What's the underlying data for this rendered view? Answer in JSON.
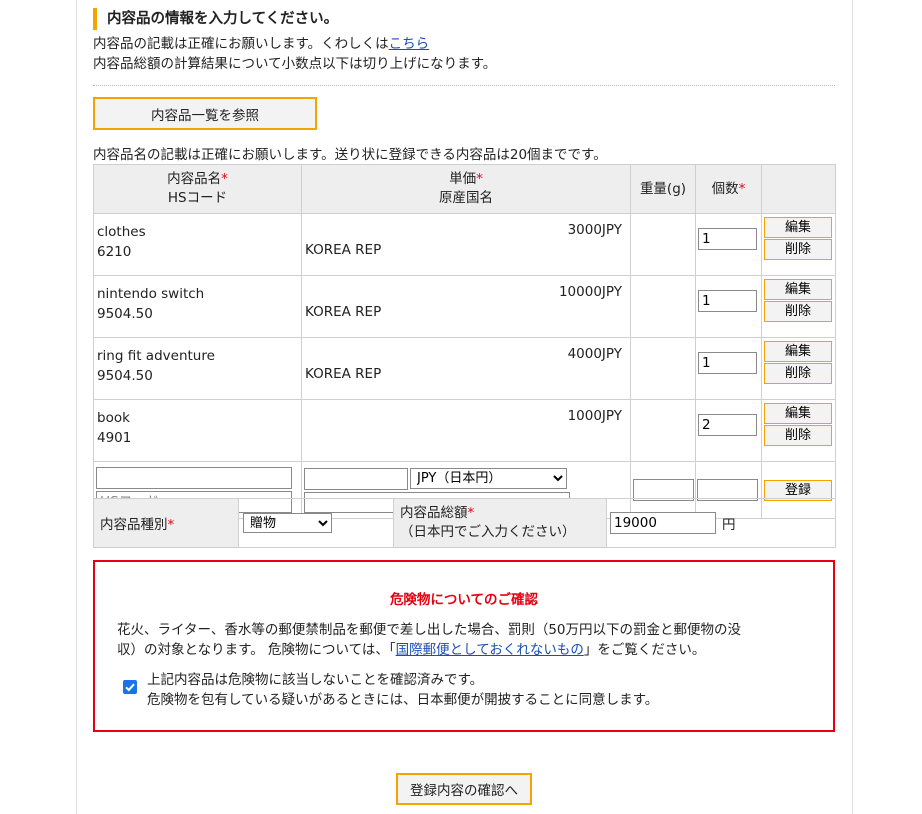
{
  "header": {
    "title": "内容品の情報を入力してください。",
    "intro_line1": "内容品の記載は正確にお願いします。くわしくは",
    "intro_link": "こちら",
    "intro_line2": "内容品総額の計算結果について小数点以下は切り上げになります。"
  },
  "browse_button": "内容品一覧を参照",
  "note": "内容品名の記載は正確にお願いします。送り状に登録できる内容品は20個までです。",
  "table": {
    "headers": {
      "name": "内容品名",
      "hscode": "HSコード",
      "price": "単価",
      "origin": "原産国名",
      "weight": "重量(g)",
      "qty": "個数",
      "required_mark": "*"
    },
    "rows": [
      {
        "name": "clothes",
        "hs": "6210",
        "price": "3000JPY",
        "origin": "KOREA REP",
        "weight": "",
        "qty": "1"
      },
      {
        "name": "nintendo switch",
        "hs": "9504.50",
        "price": "10000JPY",
        "origin": "KOREA REP",
        "weight": "",
        "qty": "1"
      },
      {
        "name": "ring fit adventure",
        "hs": "9504.50",
        "price": "4000JPY",
        "origin": "KOREA REP",
        "weight": "",
        "qty": "1"
      },
      {
        "name": "book",
        "hs": "4901",
        "price": "1000JPY",
        "origin": "",
        "weight": "",
        "qty": "2"
      }
    ],
    "edit_label": "編集",
    "delete_label": "削除",
    "new_row": {
      "name_value": "",
      "hs_placeholder": "HSコード",
      "price_value": "",
      "currency_selected": "JPY（日本円）",
      "origin_selected": "",
      "weight_value": "",
      "qty_value": "",
      "register_label": "登録"
    }
  },
  "kind": {
    "label": "内容品種別",
    "selected": "贈物",
    "total_label": "内容品総額",
    "total_sub": "（日本円でご入力ください）",
    "total_value": "19000",
    "unit": "円"
  },
  "danger": {
    "title": "危険物についてのご確認",
    "body1": "花火、ライター、香水等の郵便禁制品を郵便で差し出した場合、罰則（50万円以下の罰金と郵便物の没",
    "body2_pre": "収）の対象となります。 危険物については、「",
    "body2_link": "国際郵便としておくれないもの",
    "body2_post": "」をご覧ください。",
    "check_line1": "上記内容品は危険物に該当しないことを確認済みです。",
    "check_line2": "危険物を包有している疑いがあるときには、日本郵便が開披することに同意します。",
    "checked": true
  },
  "confirm_button": "登録内容の確認へ",
  "colors": {
    "accent": "#f5a300",
    "danger": "#e60012",
    "link": "#1a4db5",
    "checkbox": "#1a73e8"
  }
}
